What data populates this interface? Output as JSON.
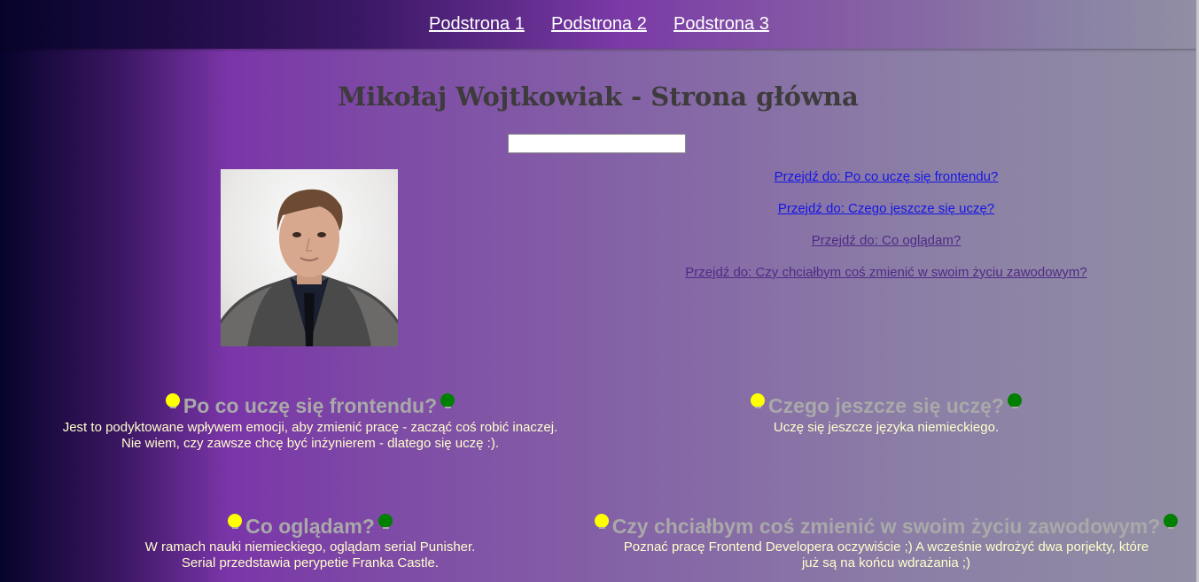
{
  "nav": {
    "links": [
      {
        "label": "Podstrona 1"
      },
      {
        "label": "Podstrona 2"
      },
      {
        "label": "Podstrona 3"
      }
    ]
  },
  "header": {
    "title": "Mikołaj Wojtkowiak - Strona główna"
  },
  "search": {
    "value": "",
    "placeholder": ""
  },
  "anchors": [
    {
      "label": "Przejdź do: Po co uczę się frontendu?",
      "color": "#1515e6"
    },
    {
      "label": "Przejdź do: Czego jeszcze się uczę?",
      "color": "#1515e6"
    },
    {
      "label": "Przejdź do: Co oglądam?",
      "color": "#4f2a86"
    },
    {
      "label": "Przejdź do: Czy chciałbym coś zmienić w swoim życiu zawodowym?",
      "color": "#4f2a86"
    }
  ],
  "sections": [
    {
      "heading": "Po co uczę się frontendu?",
      "lines": [
        "Jest to podyktowane wpływem emocji, aby zmienić pracę - zacząć coś robić inaczej.",
        "Nie wiem, czy zawsze chcę być inżynierem - dlatego się uczę :)."
      ]
    },
    {
      "heading": "Czego jeszcze się uczę?",
      "lines": [
        "Uczę się jeszcze języka niemieckiego."
      ]
    },
    {
      "heading": "Co oglądam?",
      "lines": [
        "W ramach nauki niemieckiego, oglądam serial Punisher.",
        "Serial przedstawia perypetie Franka Castle."
      ]
    },
    {
      "heading": "Czy chciałbym coś zmienić w swoim życiu zawodowym?",
      "lines": [
        "Poznać pracę Frontend Developera oczywiście ;) A wcześnie wdrożyć dwa porjekty, które",
        "już są na końcu wdrażania ;)"
      ]
    }
  ],
  "icons": {
    "left": "lightbulb-icon",
    "right": "lightbulb-icon"
  },
  "colors": {
    "bulb_left": "#ffff00",
    "bulb_right": "#008000",
    "heading": "#a9a9a9",
    "body_text": "#ffffcc",
    "title": "#3d3b3b"
  }
}
